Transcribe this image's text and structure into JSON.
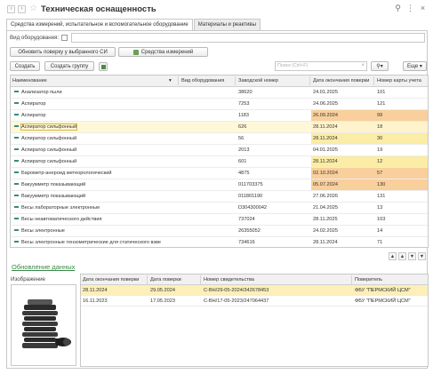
{
  "window": {
    "title": "Техническая оснащенность"
  },
  "tabs": [
    {
      "label": "Средства измерений, испытательное и вспомогательное оборудование",
      "active": true
    },
    {
      "label": "Материалы и реактивы",
      "active": false
    }
  ],
  "filter": {
    "label": "Вид оборудования:",
    "value": ""
  },
  "buttons": {
    "update_check": "Обновить поверку у выбранного СИ",
    "measuring_tools": "Средства измерений",
    "create": "Создать",
    "create_group": "Создать группу",
    "more": "Еще"
  },
  "search": {
    "placeholder": "Поиск (Ctrl+F)"
  },
  "table": {
    "headers": [
      "Наименование",
      "Вид оборудования",
      "Заводской номер",
      "Дата окончания поверки",
      "Номер карты учета"
    ],
    "rows": [
      {
        "name": "Анализатор пыли",
        "type": "",
        "serial": "38620",
        "date": "24.01.2025",
        "card": "101",
        "hl": ""
      },
      {
        "name": "Аспиратор",
        "type": "",
        "serial": "7253",
        "date": "24.06.2025",
        "card": "121",
        "hl": ""
      },
      {
        "name": "Аспиратор",
        "type": "",
        "serial": "1183",
        "date": "26.09.2024",
        "card": "99",
        "hl": "orange"
      },
      {
        "name": "Аспиратор сильфонный",
        "type": "",
        "serial": "626",
        "date": "28.11.2024",
        "card": "18",
        "hl": "light",
        "selected": true
      },
      {
        "name": "Аспиратор сильфонный",
        "type": "",
        "serial": "56",
        "date": "28.11.2024",
        "card": "30",
        "hl": "yellow"
      },
      {
        "name": "Аспиратор сильфонный",
        "type": "",
        "serial": "2013",
        "date": "04.01.2025",
        "card": "19",
        "hl": ""
      },
      {
        "name": "Аспиратор сильфонный",
        "type": "",
        "serial": "601",
        "date": "28.11.2024",
        "card": "12",
        "hl": "yellow"
      },
      {
        "name": "Барометр-анероид метеорологический",
        "type": "",
        "serial": "4875",
        "date": "02.10.2024",
        "card": "57",
        "hl": "orange"
      },
      {
        "name": "Вакуумметр показывающий",
        "type": "",
        "serial": "011703375",
        "date": "05.07.2024",
        "card": "130",
        "hl": "orange"
      },
      {
        "name": "Вакуумметр показывающий",
        "type": "",
        "serial": "011801190",
        "date": "27.06.2026",
        "card": "131",
        "hl": ""
      },
      {
        "name": "Весы лабораторные электронные",
        "type": "",
        "serial": "D304300042",
        "date": "21.04.2025",
        "card": "13",
        "hl": ""
      },
      {
        "name": "Весы неавтоматического действия",
        "type": "",
        "serial": "737024",
        "date": "28.11.2025",
        "card": "103",
        "hl": ""
      },
      {
        "name": "Весы электронные",
        "type": "",
        "serial": "26355052",
        "date": "24.02.2025",
        "card": "14",
        "hl": ""
      },
      {
        "name": "Весы электронные тензометрические для статического взве",
        "type": "",
        "serial": "734616",
        "date": "28.11.2024",
        "card": "71",
        "hl": ""
      }
    ]
  },
  "scroll_controls": [
    "▲",
    "▲",
    "▼",
    "▼"
  ],
  "update_section": {
    "link": "Обновление данных",
    "image_label": "Изображение"
  },
  "history": {
    "headers": [
      "Дата окончания поверки",
      "Дата поверки",
      "Номер свидетельства",
      "Поверитель"
    ],
    "rows": [
      {
        "end": "28.11.2024",
        "check": "29.05.2024",
        "cert": "С-ВН/29-05-2024/342678453",
        "verifier": "ФБУ \"ПЕРМСКИЙ ЦСМ\"",
        "selected": true
      },
      {
        "end": "16.11.2023",
        "check": "17.05.2023",
        "cert": "С-ВН/17-05-2023/247064437",
        "verifier": "ФБУ \"ПЕРМСКИЙ ЦСМ\"",
        "selected": false
      }
    ]
  },
  "colors": {
    "highlight_orange": "#f9cf9c",
    "highlight_yellow": "#fbeca6",
    "link_green": "#3a8a4a"
  }
}
